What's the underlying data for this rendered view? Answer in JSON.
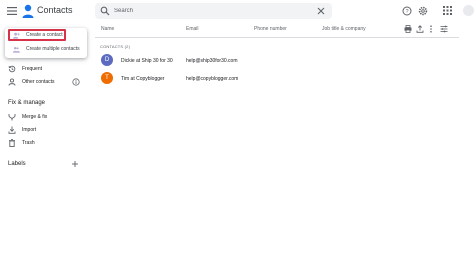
{
  "header": {
    "app_title": "Contacts",
    "search_placeholder": "Search",
    "icons": [
      "menu-icon",
      "contacts-logo",
      "search-icon",
      "close-icon",
      "help-icon",
      "settings-icon",
      "apps-icon",
      "account-avatar"
    ]
  },
  "create_menu": {
    "items": [
      {
        "label": "Create a contact",
        "icon": "person-add-icon"
      },
      {
        "label": "Create multiple contacts",
        "icon": "people-add-icon"
      }
    ],
    "highlight_color": "#d6334a"
  },
  "sidebar": {
    "nav": [
      {
        "label": "Frequent",
        "icon": "history-icon"
      },
      {
        "label": "Other contacts",
        "icon": "person-icon"
      }
    ],
    "fix_manage_title": "Fix & manage",
    "fix_manage": [
      {
        "label": "Merge & fix",
        "icon": "merge-icon"
      },
      {
        "label": "Import",
        "icon": "import-icon"
      },
      {
        "label": "Trash",
        "icon": "trash-icon"
      }
    ],
    "labels_title": "Labels"
  },
  "table": {
    "columns": [
      "Name",
      "Email",
      "Phone number",
      "Job title & company"
    ],
    "group_label": "CONTACTS (2)",
    "rows": [
      {
        "initial": "D",
        "name": "Dickie at Ship 30 for 30",
        "email": "help@ship30for30.com",
        "avatar_color": "#5c6bc0"
      },
      {
        "initial": "T",
        "name": "Tim at Copyblogger",
        "email": "help@copyblogger.com",
        "avatar_color": "#ef6c00"
      }
    ]
  },
  "colors": {
    "accent": "#1a73e8",
    "search_bg": "#f1f3f4",
    "icon_gray": "#5f6368"
  }
}
